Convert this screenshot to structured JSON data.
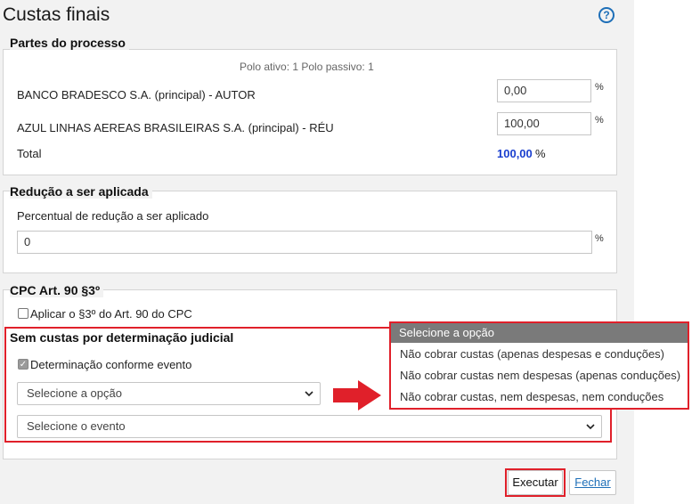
{
  "page": {
    "title": "Custas finais"
  },
  "partes": {
    "legend": "Partes do processo",
    "polo_summary": "Polo ativo: 1 Polo passivo: 1",
    "rows": [
      {
        "name": "BANCO BRADESCO S.A. (principal) - AUTOR",
        "value": "0,00",
        "unit": "%"
      },
      {
        "name": "AZUL LINHAS AEREAS BRASILEIRAS S.A. (principal) - RÉU",
        "value": "100,00",
        "unit": "%"
      }
    ],
    "total_label": "Total",
    "total_value": "100,00",
    "total_unit": "%"
  },
  "reducao": {
    "legend": "Redução a ser aplicada",
    "label": "Percentual de redução a ser aplicado",
    "value": "0",
    "unit": "%"
  },
  "cpc": {
    "legend": "CPC Art. 90 §3º",
    "checkbox_label": "Aplicar o §3º do Art. 90 do CPC",
    "checked": false
  },
  "sem_custas": {
    "legend": "Sem custas por determinação judicial",
    "checkbox_label": "Determinação conforme evento",
    "checked": true,
    "select_option": "Selecione a opção",
    "select_event": "Selecione o evento"
  },
  "dropdown": {
    "options": [
      "Selecione a opção",
      "Não cobrar custas (apenas despesas e conduções)",
      "Não cobrar custas nem despesas (apenas conduções)",
      "Não cobrar custas, nem despesas, nem conduções"
    ],
    "selected_index": 0
  },
  "buttons": {
    "executar": "Executar",
    "fechar": "Fechar"
  },
  "colors": {
    "highlight": "#e0202a",
    "total_blue": "#1a3fcf",
    "help_blue": "#1e6fb8"
  }
}
